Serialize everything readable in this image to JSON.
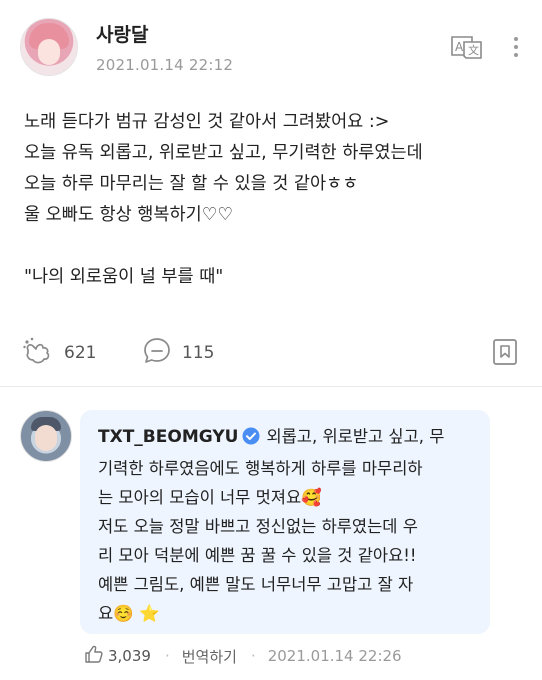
{
  "post": {
    "author": "사랑달",
    "date": "2021.01.14 22:12",
    "lines": [
      "노래 듣다가 범규 감성인 것 같아서 그려봤어요 :>",
      "오늘 유독 외롭고, 위로받고 싶고, 무기력한 하루였는데",
      "오늘 하루 마무리는 잘 할 수 있을 것 같아ㅎㅎ",
      "울 오빠도 항상 행복하기♡♡",
      "",
      "\"나의 외로움이 널 부를 때\""
    ],
    "likes": "621",
    "comments": "115"
  },
  "reply": {
    "author": "TXT_BEOMGYU",
    "lines": [
      "외롭고, 위로받고 싶고, 무",
      "기력한 하루였음에도 행복하게 하루를 마무리하",
      "는 모아의 모습이 너무 멋져요🥰",
      "저도 오늘 정말 바쁘고 정신없는 하루였는데 우",
      "리 모아 덕분에 예쁜 꿈 꿀 수 있을 것 같아요!!",
      "예쁜 그림도, 예쁜 말도 너무너무 고맙고 잘 자",
      "요☺️ ⭐"
    ],
    "likes": "3,039",
    "translate_label": "번역하기",
    "date": "2021.01.14 22:26"
  },
  "icons": {
    "translate": "translate-icon",
    "more": "more-vertical-icon",
    "like": "cheer-icon",
    "comment": "comment-icon",
    "bookmark": "bookmark-icon",
    "verified": "verified-badge-icon",
    "reply_like": "thumbs-up-icon"
  },
  "colors": {
    "bubble_bg": "#eef5fe",
    "verified_blue": "#4a8ef3",
    "muted_text": "#9a9a9a"
  }
}
